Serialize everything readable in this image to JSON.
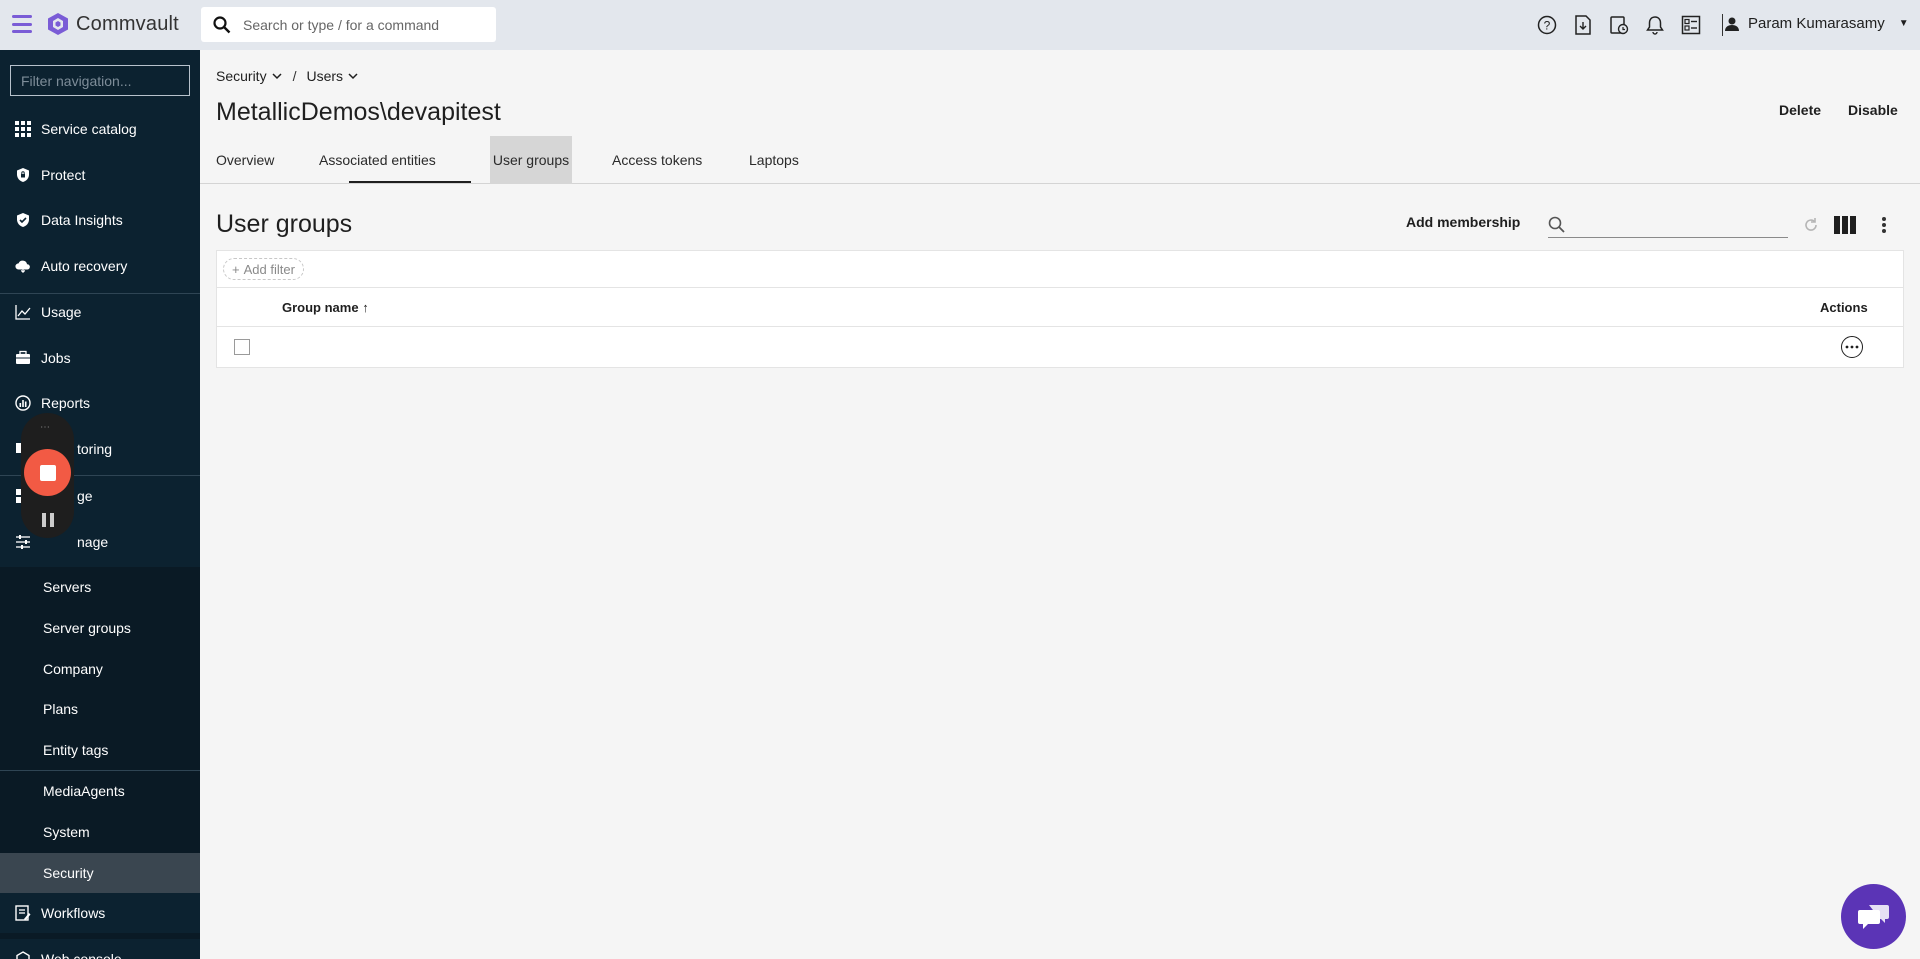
{
  "topbar": {
    "brand": "Commvault",
    "search_placeholder": "Search or type / for a command",
    "user_name": "Param Kumarasamy",
    "brand_color": "#7a5cd6"
  },
  "sidebar": {
    "filter_placeholder": "Filter navigation...",
    "items": [
      {
        "label": "Service catalog",
        "icon": "grid-icon"
      },
      {
        "label": "Protect",
        "icon": "shield-lock-icon"
      },
      {
        "label": "Data Insights",
        "icon": "shield-check-icon"
      },
      {
        "label": "Auto recovery",
        "icon": "cloud-sync-icon"
      },
      {
        "label": "Usage",
        "icon": "line-chart-icon"
      },
      {
        "label": "Jobs",
        "icon": "briefcase-icon"
      },
      {
        "label": "Reports",
        "icon": "reports-icon"
      },
      {
        "label": "Monitoring",
        "icon": "monitor-icon",
        "visible_text": "toring"
      },
      {
        "label": "Storage",
        "icon": "storage-icon",
        "visible_text": "ge"
      },
      {
        "label": "Manage",
        "icon": "sliders-icon",
        "visible_text": "nage"
      }
    ],
    "sub_items": [
      "Servers",
      "Server groups",
      "Company",
      "Plans",
      "Entity tags",
      "MediaAgents",
      "System",
      "Security"
    ],
    "bottom_items": [
      {
        "label": "Workflows",
        "icon": "workflow-icon"
      },
      {
        "label": "Web console",
        "icon": "web-console-icon"
      }
    ]
  },
  "main": {
    "breadcrumb": [
      "Security",
      "Users"
    ],
    "breadcrumb_sep": "/",
    "title": "MetallicDemos\\devapitest",
    "actions": {
      "delete": "Delete",
      "disable": "Disable"
    },
    "tabs": [
      "Overview",
      "Associated entities",
      "User groups",
      "Access tokens",
      "Laptops"
    ],
    "section_title": "User groups",
    "add_membership": "Add membership",
    "add_filter": "Add filter",
    "columns": {
      "group_name": "Group name",
      "sort_arrow": "↑",
      "actions": "Actions"
    }
  }
}
